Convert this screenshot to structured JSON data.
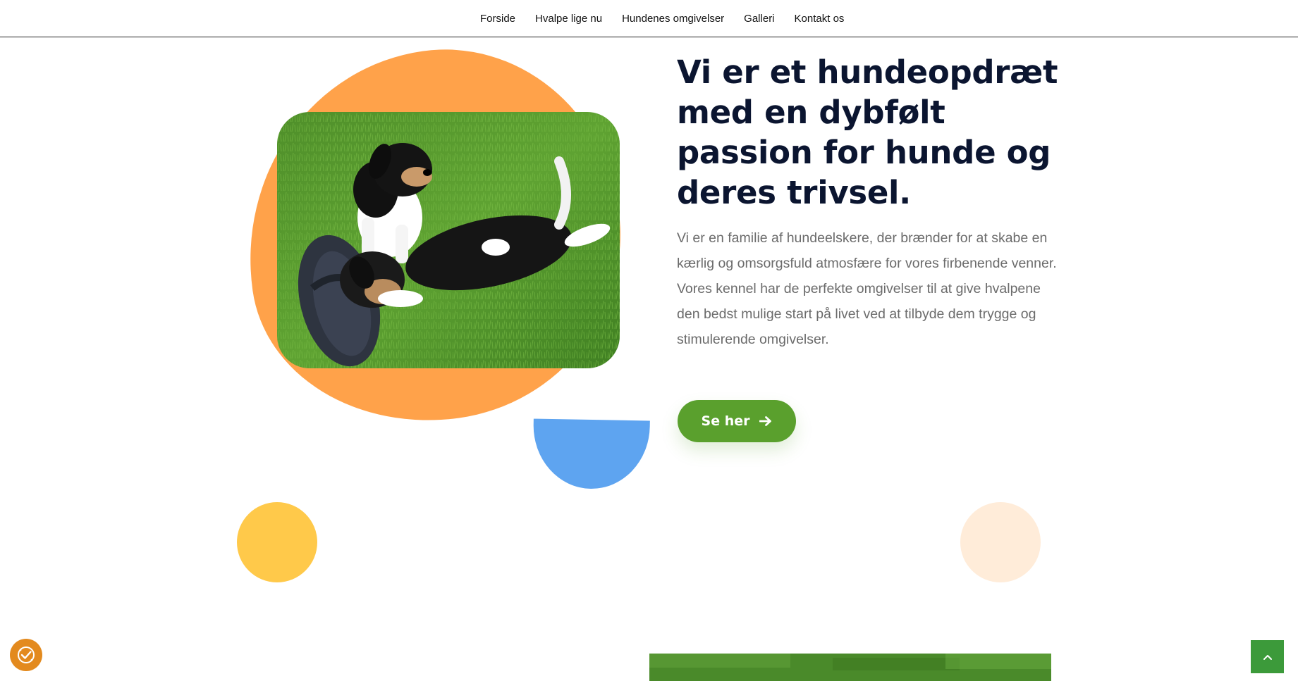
{
  "nav": {
    "items": [
      {
        "label": "Forside"
      },
      {
        "label": "Hvalpe lige nu"
      },
      {
        "label": "Hundenes omgivelser"
      },
      {
        "label": "Galleri"
      },
      {
        "label": "Kontakt os"
      }
    ]
  },
  "hero": {
    "title": "Vi er et hundeopdræt med en dybfølt passion for hunde og deres trivsel.",
    "text": "Vi er en familie af hundeelskere, der brænder for at skabe en kærlig og omsorgsfuld atmosfære for vores firbenende venner. Vores kennel har de perfekte omgivelser til at give hvalpene den bedst mulige start på livet ved at tilbyde dem trygge og stimulerende omgivelser.",
    "cta_label": "Se her",
    "cta_icon": "arrow-right-icon"
  },
  "colors": {
    "accent_orange": "#ffa24a",
    "accent_blue": "#5ea4f0",
    "accent_yellow": "#ffc94a",
    "accent_peach": "#ffecd9",
    "cta_green": "#5aa02d",
    "title_navy": "#0b1530",
    "scroll_top_green": "#3c9a3a",
    "cookie_orange": "#e38a1e"
  },
  "widgets": {
    "cookie_icon": "cookie-consent-icon",
    "scroll_top_icon": "chevron-up-icon"
  }
}
